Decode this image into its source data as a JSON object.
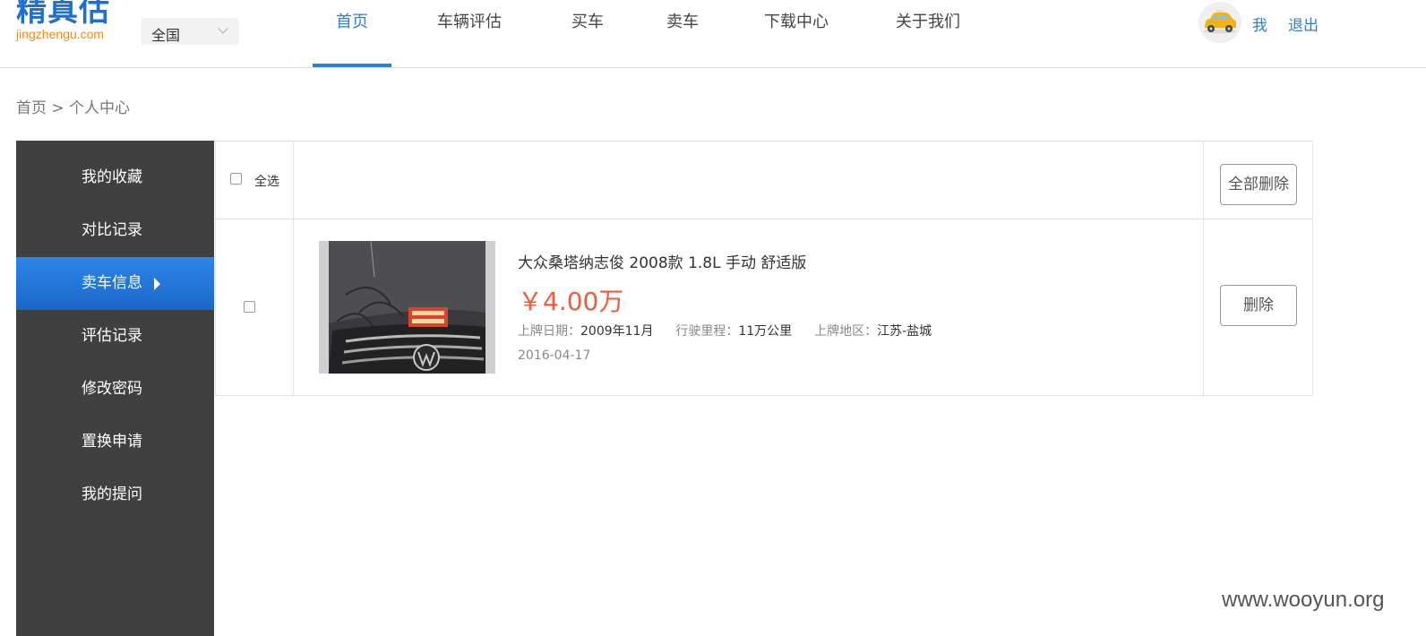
{
  "header": {
    "logo_text": "精真估",
    "logo_domain": "jingzhengu.com",
    "region": "全国",
    "nav": [
      "首页",
      "车辆评估",
      "买车",
      "卖车",
      "下载中心",
      "关于我们"
    ],
    "active_nav": "首页",
    "user": {
      "avatar_icon": "car-avatar-icon",
      "me_label": "我",
      "logout_label": "退出"
    }
  },
  "breadcrumb": {
    "home": "首页",
    "separator": ">",
    "current": "个人中心"
  },
  "sidebar": {
    "items": [
      {
        "label": "我的收藏"
      },
      {
        "label": "对比记录"
      },
      {
        "label": "卖车信息",
        "active": true
      },
      {
        "label": "评估记录"
      },
      {
        "label": "修改密码"
      },
      {
        "label": "置换申请"
      },
      {
        "label": "我的提问"
      }
    ]
  },
  "table": {
    "select_all_label": "全选",
    "delete_all_label": "全部删除",
    "rows": [
      {
        "title": "大众桑塔纳志俊 2008款 1.8L 手动 舒适版",
        "price": "￥4.00万",
        "reg_date_label": "上牌日期：",
        "reg_date": "2009年11月",
        "mileage_label": "行驶里程：",
        "mileage": "11万公里",
        "region_label": "上牌地区：",
        "region": "江苏-盐城",
        "posted": "2016-04-17",
        "delete_label": "删除"
      }
    ]
  },
  "watermark": "www.wooyun.org",
  "colors": {
    "accent": "#2a7fe0",
    "price": "#f15a3a",
    "sidebar_bg": "#404040",
    "logo_orange": "#f08a1c"
  }
}
